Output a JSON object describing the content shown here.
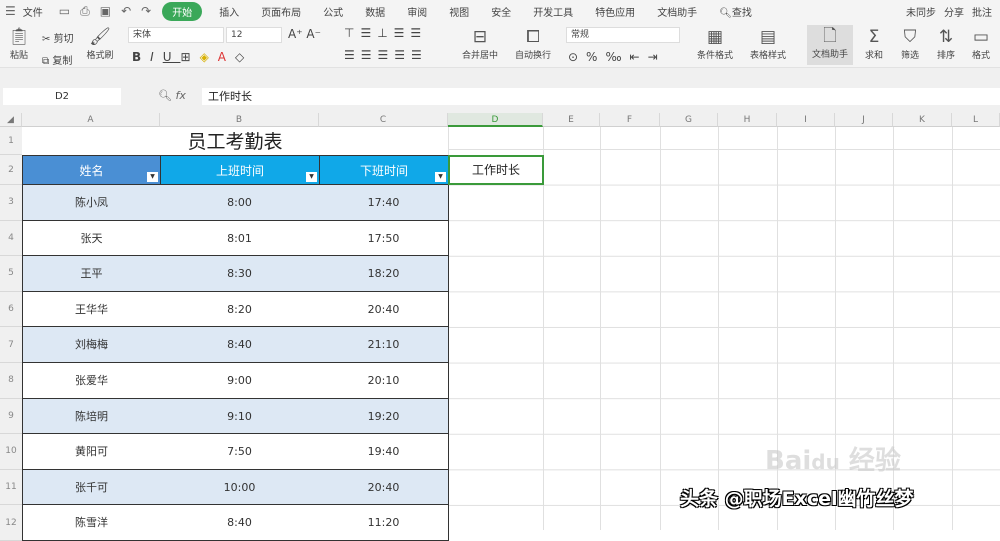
{
  "menu": {
    "file": "文件",
    "tabs": [
      "开始",
      "插入",
      "页面布局",
      "公式",
      "数据",
      "审阅",
      "视图",
      "安全",
      "开发工具",
      "特色应用",
      "文档助手"
    ],
    "search": "查找",
    "sync": "未同步",
    "share": "分享",
    "comment": "批注"
  },
  "toolbar": {
    "paste": "粘贴",
    "cut": "剪切",
    "copy": "复制",
    "format_painter": "格式刷",
    "font": "宋体",
    "size": "12",
    "merge": "合并居中",
    "wrap": "自动换行",
    "number_format": "常规",
    "cond_format": "条件格式",
    "table_style": "表格样式",
    "doc_helper": "文档助手",
    "sum": "求和",
    "filter": "筛选",
    "sort": "排序",
    "format": "格式"
  },
  "formula": {
    "cell_ref": "D2",
    "fx": "fx",
    "value": "工作时长"
  },
  "columns": [
    "A",
    "B",
    "C",
    "D",
    "E",
    "F",
    "G",
    "H",
    "I",
    "J",
    "K",
    "L"
  ],
  "rows": [
    "1",
    "2",
    "3",
    "4",
    "5",
    "6",
    "7",
    "8",
    "9",
    "10",
    "11",
    "12"
  ],
  "sheet": {
    "title": "员工考勤表",
    "headers": [
      "姓名",
      "上班时间",
      "下班时间"
    ],
    "d2": "工作时长",
    "data": [
      [
        "陈小凤",
        "8:00",
        "17:40"
      ],
      [
        "张天",
        "8:01",
        "17:50"
      ],
      [
        "王平",
        "8:30",
        "18:20"
      ],
      [
        "王华华",
        "8:20",
        "20:40"
      ],
      [
        "刘梅梅",
        "8:40",
        "21:10"
      ],
      [
        "张爱华",
        "9:00",
        "20:10"
      ],
      [
        "陈培明",
        "9:10",
        "19:20"
      ],
      [
        "黄阳可",
        "7:50",
        "19:40"
      ],
      [
        "张千可",
        "10:00",
        "20:40"
      ],
      [
        "陈雪洋",
        "8:40",
        "11:20"
      ]
    ]
  },
  "watermark": "头条 @职场Excel幽竹丝梦",
  "baidu": "Baidu经验",
  "colors": {
    "header_a": "#4a8fd4",
    "header_bc": "#10a8e8",
    "band": "#dde8f4",
    "accent": "#3aa859"
  }
}
